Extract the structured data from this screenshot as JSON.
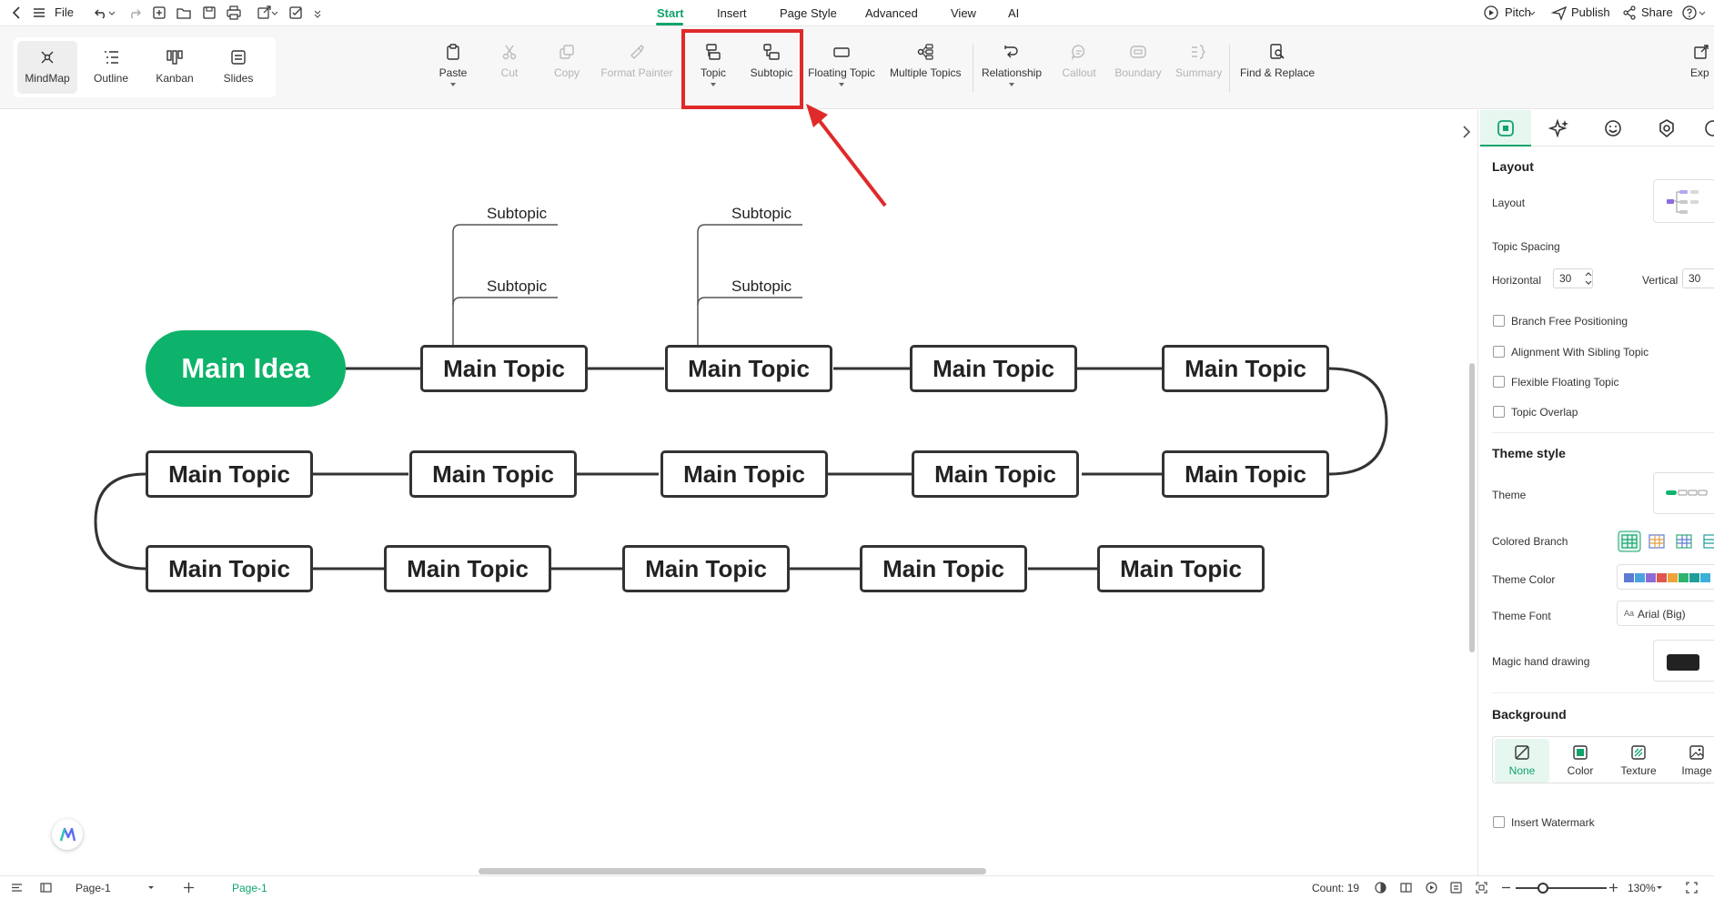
{
  "menubar": {
    "file_label": "File",
    "tabs": [
      {
        "label": "Start",
        "active": true
      },
      {
        "label": "Insert",
        "active": false
      },
      {
        "label": "Page Style",
        "active": false
      },
      {
        "label": "Advanced",
        "active": false
      },
      {
        "label": "View",
        "active": false
      },
      {
        "label": "AI",
        "active": false
      }
    ],
    "right": {
      "pitch_label": "Pitch",
      "publish_label": "Publish",
      "share_label": "Share"
    }
  },
  "toolbar": {
    "views": [
      {
        "label": "MindMap",
        "icon": "mindmap-icon",
        "active": true
      },
      {
        "label": "Outline",
        "icon": "outline-icon",
        "active": false
      },
      {
        "label": "Kanban",
        "icon": "kanban-icon",
        "active": false
      },
      {
        "label": "Slides",
        "icon": "slides-icon",
        "active": false
      }
    ],
    "tools": [
      {
        "label": "Paste",
        "icon": "paste-icon",
        "enabled": true,
        "dropdown": true
      },
      {
        "label": "Cut",
        "icon": "cut-icon",
        "enabled": false,
        "dropdown": false
      },
      {
        "label": "Copy",
        "icon": "copy-icon",
        "enabled": false,
        "dropdown": false
      },
      {
        "label": "Format Painter",
        "icon": "format-painter-icon",
        "enabled": false,
        "dropdown": false
      },
      {
        "label": "Topic",
        "icon": "topic-icon",
        "enabled": true,
        "dropdown": true
      },
      {
        "label": "Subtopic",
        "icon": "subtopic-icon",
        "enabled": true,
        "dropdown": false
      },
      {
        "label": "Floating Topic",
        "icon": "floating-topic-icon",
        "enabled": true,
        "dropdown": true
      },
      {
        "label": "Multiple Topics",
        "icon": "multiple-topics-icon",
        "enabled": true,
        "dropdown": false
      },
      {
        "label": "Relationship",
        "icon": "relationship-icon",
        "enabled": true,
        "dropdown": true
      },
      {
        "label": "Callout",
        "icon": "callout-icon",
        "enabled": false,
        "dropdown": false
      },
      {
        "label": "Boundary",
        "icon": "boundary-icon",
        "enabled": false,
        "dropdown": false
      },
      {
        "label": "Summary",
        "icon": "summary-icon",
        "enabled": false,
        "dropdown": false
      },
      {
        "label": "Find & Replace",
        "icon": "find-replace-icon",
        "enabled": true,
        "dropdown": false
      },
      {
        "label": "Exp",
        "icon": "export-icon",
        "enabled": true,
        "dropdown": false
      }
    ]
  },
  "mindmap": {
    "main_idea": "Main Idea",
    "topic_label": "Main Topic",
    "subtopic_label": "Subtopic"
  },
  "right_panel": {
    "layout_section": "Layout",
    "layout_label": "Layout",
    "topic_spacing_label": "Topic Spacing",
    "horizontal_label": "Horizontal",
    "horizontal_value": "30",
    "vertical_label": "Vertical",
    "vertical_value": "30",
    "checkboxes": [
      {
        "label": "Branch Free Positioning",
        "checked": false
      },
      {
        "label": "Alignment With Sibling Topic",
        "checked": false
      },
      {
        "label": "Flexible Floating Topic",
        "checked": false
      },
      {
        "label": "Topic Overlap",
        "checked": false
      }
    ],
    "theme_section": "Theme style",
    "theme_label": "Theme",
    "colored_branch_label": "Colored Branch",
    "theme_color_label": "Theme Color",
    "theme_font_label": "Theme Font",
    "theme_font_value": "Arial (Big)",
    "magic_label": "Magic hand drawing",
    "background_section": "Background",
    "bg_options": [
      {
        "label": "None",
        "active": true
      },
      {
        "label": "Color",
        "active": false
      },
      {
        "label": "Texture",
        "active": false
      },
      {
        "label": "Image",
        "active": false
      }
    ],
    "watermark_label": "Insert Watermark",
    "theme_colors": [
      "#5b7bd5",
      "#4aa3df",
      "#8e6bd6",
      "#e0574f",
      "#f0a33a",
      "#2fb36f",
      "#1e9e9a",
      "#3ab0d9"
    ]
  },
  "statusbar": {
    "page_select": "Page-1",
    "page_tab": "Page-1",
    "count_text": "Count: 19",
    "zoom_text": "130%"
  },
  "colors": {
    "accent": "#10a36b",
    "main_idea_fill": "#0db36a",
    "annotation_red": "#e02a2a"
  }
}
